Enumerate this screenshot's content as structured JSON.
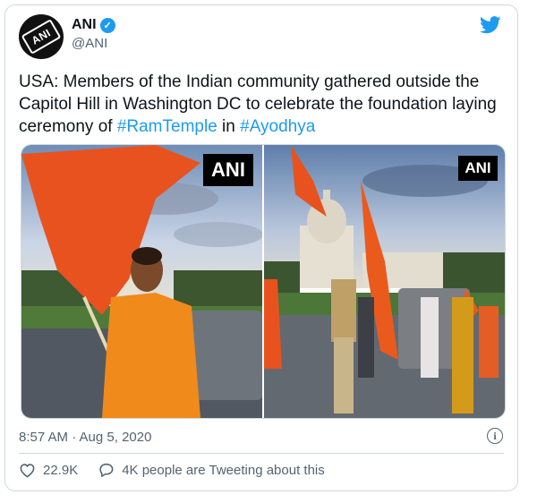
{
  "author": {
    "name": "ANI",
    "handle": "@ANI",
    "avatar_text": "ANI"
  },
  "tweet": {
    "text_before": "USA: Members of the Indian community gathered outside the Capitol Hill in Washington DC to celebrate the foundation laying ceremony of ",
    "hashtag1": "#RamTemple",
    "text_middle": " in ",
    "hashtag2": "#Ayodhya"
  },
  "media": {
    "watermark_left": "ANI",
    "watermark_right": "ANI"
  },
  "meta": {
    "timestamp": "8:57 AM · Aug 5, 2020"
  },
  "actions": {
    "likes": "22.9K",
    "replies_text": "4K people are Tweeting about this"
  },
  "icons": {
    "brand": "twitter-bird-icon",
    "verified": "verified-badge-icon",
    "info": "info-icon",
    "like": "heart-icon",
    "reply": "comment-icon"
  },
  "colors": {
    "accent": "#1d9bf0",
    "text": "#0f1419",
    "muted": "#536471",
    "border": "#cfd9de"
  }
}
